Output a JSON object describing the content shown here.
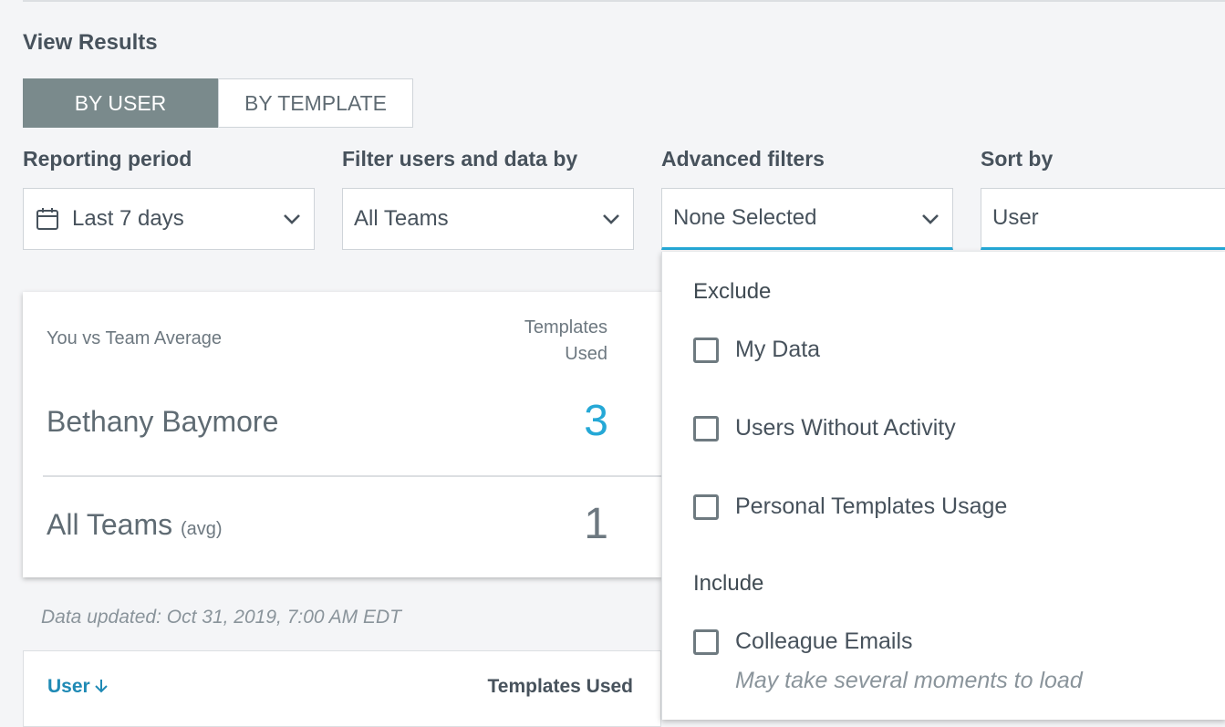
{
  "header": {
    "title": "View Results"
  },
  "view_toggle": {
    "by_user": "BY USER",
    "by_template": "BY TEMPLATE",
    "selected": "by_user"
  },
  "filters": {
    "reporting_period": {
      "label": "Reporting period",
      "value": "Last 7 days",
      "icon": "calendar-icon"
    },
    "filter_users": {
      "label": "Filter users and data by",
      "value": "All Teams"
    },
    "advanced": {
      "label": "Advanced filters",
      "value": "None Selected"
    },
    "sort_by": {
      "label": "Sort by",
      "value": "User"
    }
  },
  "comparison_card": {
    "caption": "You vs Team Average",
    "column_header_line1": "Templates",
    "column_header_line2": "Used",
    "user_name": "Bethany Baymore",
    "user_value": "3",
    "team_name": "All Teams",
    "team_suffix": "(avg)",
    "team_value": "1"
  },
  "data_updated": "Data updated: Oct 31, 2019, 7:00 AM EDT",
  "table": {
    "col_user": "User",
    "col_templates": "Templates Used"
  },
  "advanced_dropdown": {
    "exclude_heading": "Exclude",
    "exclude_options": [
      "My Data",
      "Users Without Activity",
      "Personal Templates Usage"
    ],
    "include_heading": "Include",
    "include_options": [
      "Colleague Emails"
    ],
    "include_note": "May take several moments to load"
  },
  "colors": {
    "accent": "#25a8d6",
    "toggle_active": "#7a8a8c",
    "link": "#1f8ab5"
  }
}
